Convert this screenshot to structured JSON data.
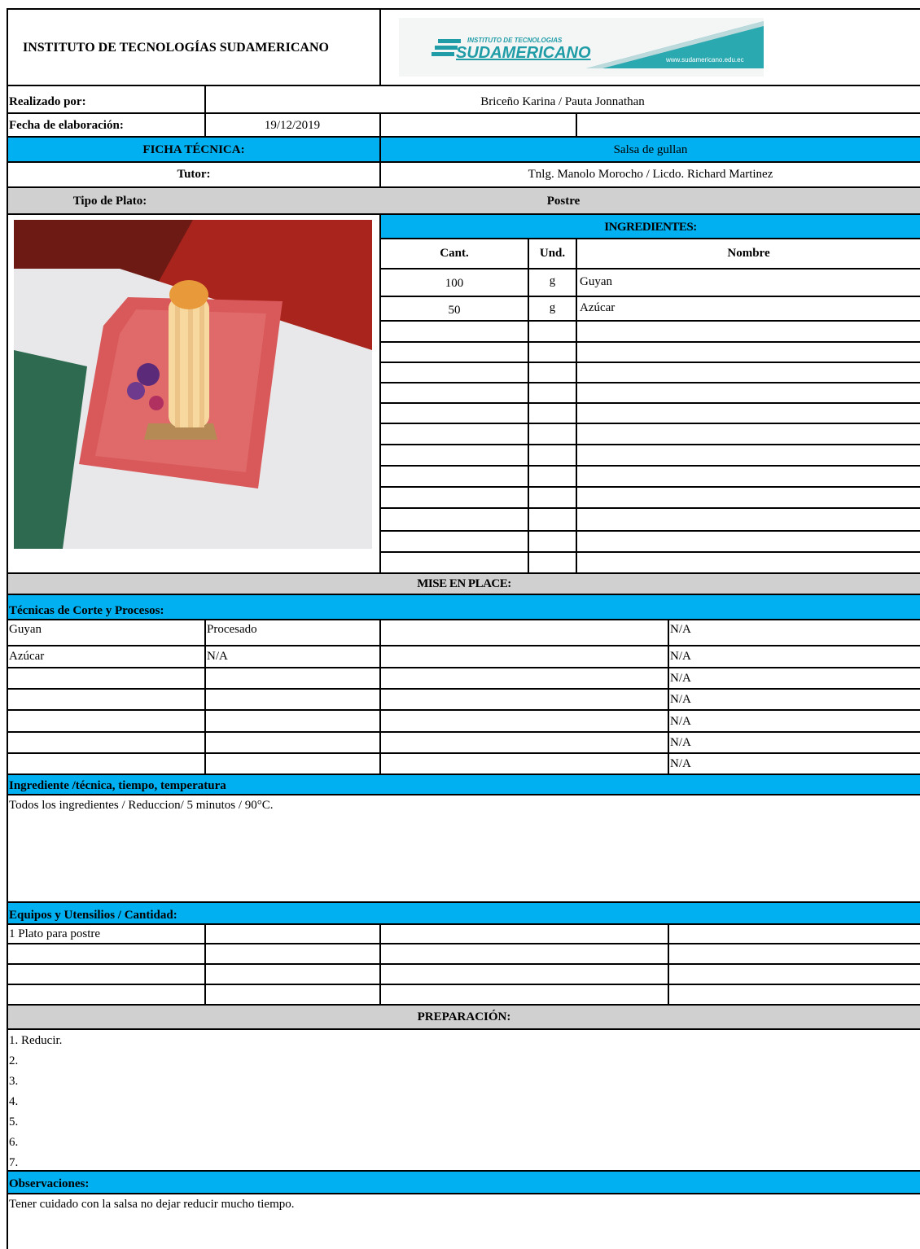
{
  "header": {
    "institute": "INSTITUTO DE TECNOLOGÍAS SUDAMERICANO",
    "logo_small": "INSTITUTO DE TECNOLOGIAS",
    "logo_big": "SUDAMERICANO",
    "logo_url": "www.sudamericano.edu.ec"
  },
  "info": {
    "realizado_label": "Realizado por:",
    "realizado_value": "Briceño Karina / Pauta Jonnathan",
    "fecha_label": "Fecha de elaboración:",
    "fecha_value": "19/12/2019",
    "ficha_label": "FICHA TÉCNICA:",
    "ficha_value": "Salsa de gullan",
    "tutor_label": "Tutor:",
    "tutor_value": "Tnlg. Manolo Morocho / Licdo. Richard Martinez",
    "tipo_label": "Tipo de Plato:",
    "tipo_value": "Postre"
  },
  "ingredients": {
    "title": "INGREDIENTES:",
    "headers": [
      "Cant.",
      "Und.",
      "Nombre"
    ],
    "rows": [
      {
        "cant": "100",
        "und": "g",
        "nombre": "Guyan"
      },
      {
        "cant": "50",
        "und": "g",
        "nombre": "Azúcar"
      }
    ]
  },
  "mise": {
    "title": "MISE EN PLACE:",
    "tecnicas_label": "Técnicas de Corte y Procesos:",
    "rows": [
      {
        "ing": "Guyan",
        "proc": "Procesado",
        "na": "N/A"
      },
      {
        "ing": "Azúcar",
        "proc": "N/A",
        "na": "N/A"
      },
      {
        "ing": "",
        "proc": "",
        "na": "N/A"
      },
      {
        "ing": "",
        "proc": "",
        "na": "N/A"
      },
      {
        "ing": "",
        "proc": "",
        "na": "N/A"
      },
      {
        "ing": "",
        "proc": "",
        "na": "N/A"
      },
      {
        "ing": "",
        "proc": "",
        "na": "N/A"
      }
    ]
  },
  "itt": {
    "label": "Ingrediente /técnica, tiempo, temperatura",
    "text": "Todos los ingredientes / Reduccion/ 5 minutos / 90°C."
  },
  "equipos": {
    "label": "Equipos y Utensilios / Cantidad:",
    "item1": "1 Plato para postre"
  },
  "preparacion": {
    "title": "PREPARACIÓN:",
    "steps": [
      "1. Reducir.",
      "2.",
      "3.",
      "4.",
      "5.",
      "6.",
      "7."
    ]
  },
  "observaciones": {
    "label": "Observaciones:",
    "text": "Tener cuidado con la salsa no dejar reducir mucho tiempo."
  },
  "colors": {
    "accent": "#00b0f0",
    "band_gray": "#d0d0d0",
    "logo_teal": "#2aa9b0"
  }
}
